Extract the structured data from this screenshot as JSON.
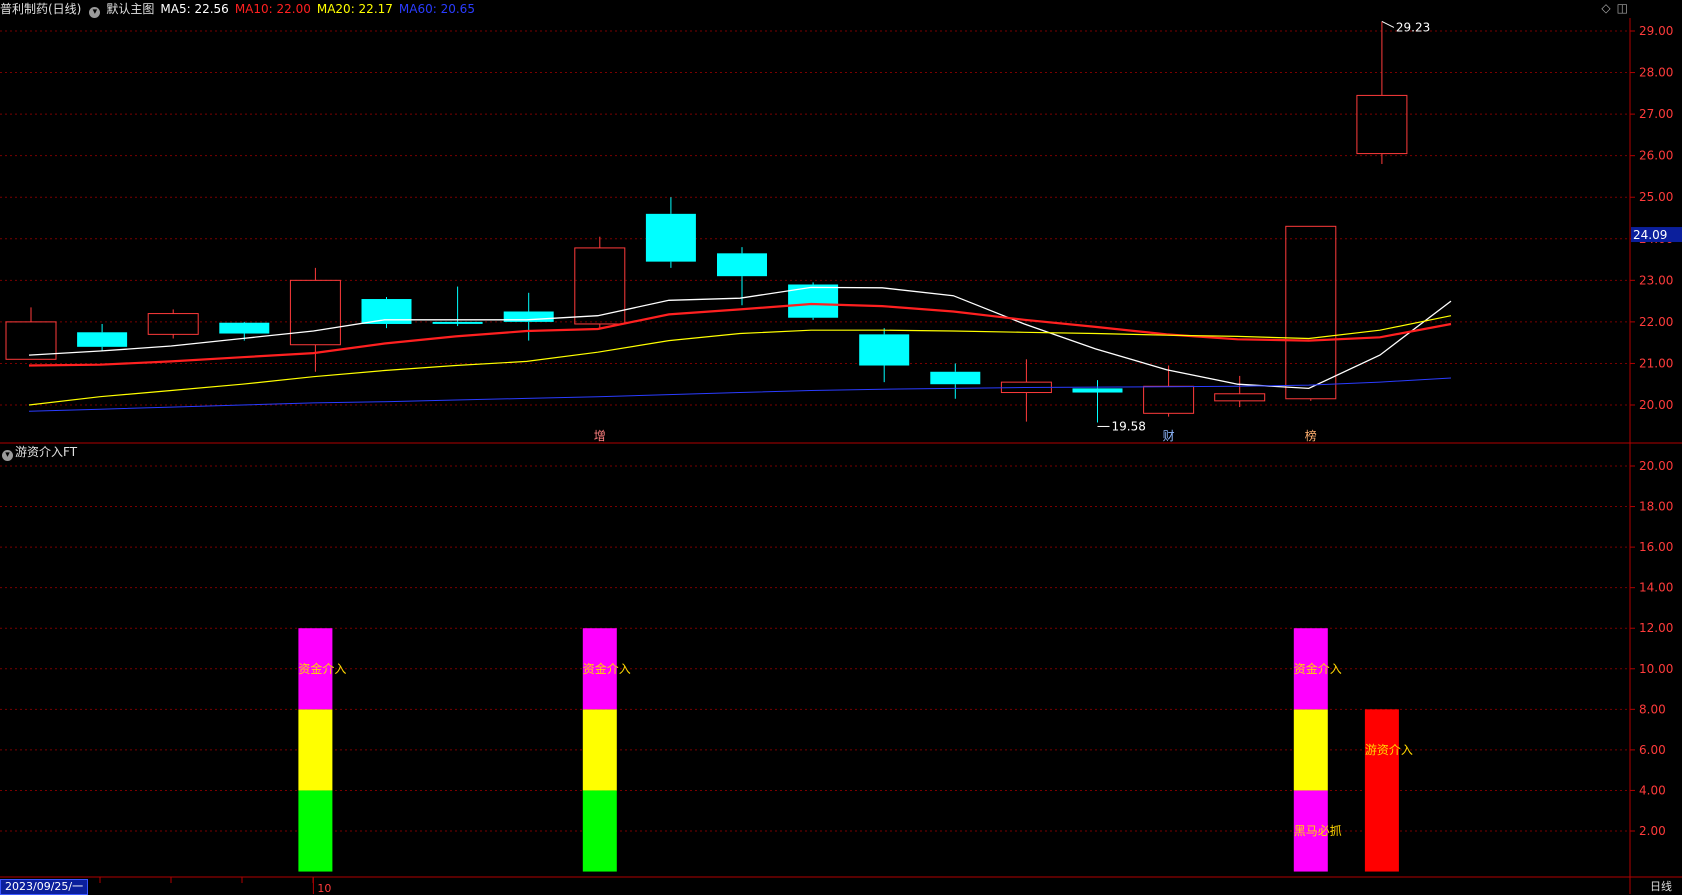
{
  "header": {
    "stock": "普利制药(日线)",
    "template": "默认主图",
    "ma": [
      {
        "label": "MA5: 22.56",
        "color": "#ffffff"
      },
      {
        "label": "MA10: 22.00",
        "color": "#ff2020"
      },
      {
        "label": "MA20: 22.17",
        "color": "#ffff00"
      },
      {
        "label": "MA60: 20.65",
        "color": "#2a3cff"
      }
    ],
    "icons": [
      "diamond-icon",
      "window-icon"
    ]
  },
  "sub_header": {
    "indicator": "游资介入FT"
  },
  "footer": {
    "date": "2023/09/25/一",
    "month_tick": "10",
    "period": "日线"
  },
  "colors": {
    "up": "#ff3b3b",
    "down": "#00ffff",
    "grid": "#7a0000",
    "axis": "#b00000",
    "ma5": "#ffffff",
    "ma10": "#ff2020",
    "ma20": "#ffff00",
    "ma60": "#2a3cff"
  },
  "chart_data": [
    {
      "type": "candlestick",
      "title": "普利制药(日线)",
      "ylim": [
        19.2,
        29.6
      ],
      "yticks": [
        "29.00",
        "28.00",
        "27.00",
        "26.00",
        "25.00",
        "24.00",
        "23.00",
        "22.00",
        "21.00",
        "20.00"
      ],
      "current_price": "24.09",
      "max_label": "29.23",
      "min_label": "19.58",
      "candles": [
        {
          "o": 21.1,
          "c": 22.0,
          "h": 22.35,
          "l": 21.1
        },
        {
          "o": 21.75,
          "c": 21.4,
          "h": 21.95,
          "l": 21.3
        },
        {
          "o": 21.7,
          "c": 22.2,
          "h": 22.3,
          "l": 21.6
        },
        {
          "o": 21.98,
          "c": 21.72,
          "h": 22.0,
          "l": 21.55
        },
        {
          "o": 21.45,
          "c": 23.0,
          "h": 23.3,
          "l": 20.8
        },
        {
          "o": 22.55,
          "c": 21.95,
          "h": 22.6,
          "l": 21.85
        },
        {
          "o": 22.0,
          "c": 21.97,
          "h": 22.85,
          "l": 21.9
        },
        {
          "o": 22.25,
          "c": 22.0,
          "h": 22.7,
          "l": 21.55
        },
        {
          "o": 21.95,
          "c": 23.78,
          "h": 24.05,
          "l": 21.85
        },
        {
          "o": 24.6,
          "c": 23.45,
          "h": 25.0,
          "l": 23.3
        },
        {
          "o": 23.65,
          "c": 23.1,
          "h": 23.8,
          "l": 22.4
        },
        {
          "o": 22.9,
          "c": 22.1,
          "h": 22.95,
          "l": 22.05
        },
        {
          "o": 21.7,
          "c": 20.95,
          "h": 21.85,
          "l": 20.55
        },
        {
          "o": 20.8,
          "c": 20.5,
          "h": 21.0,
          "l": 20.15
        },
        {
          "o": 20.3,
          "c": 20.55,
          "h": 21.1,
          "l": 19.6
        },
        {
          "o": 20.4,
          "c": 20.3,
          "h": 20.6,
          "l": 19.58
        },
        {
          "o": 19.8,
          "c": 20.45,
          "h": 20.95,
          "l": 19.72
        },
        {
          "o": 20.1,
          "c": 20.27,
          "h": 20.7,
          "l": 19.95
        },
        {
          "o": 20.15,
          "c": 24.3,
          "h": 24.3,
          "l": 20.1
        },
        {
          "o": 26.05,
          "c": 27.45,
          "h": 29.23,
          "l": 25.8
        }
      ],
      "series": [
        {
          "name": "MA5",
          "values": [
            21.2,
            21.3,
            21.42,
            21.6,
            21.78,
            22.05,
            22.05,
            22.05,
            22.15,
            22.52,
            22.57,
            22.83,
            22.82,
            22.63,
            21.95,
            21.35,
            20.85,
            20.5,
            20.4,
            21.2,
            22.5
          ]
        },
        {
          "name": "MA10",
          "values": [
            20.95,
            20.97,
            21.05,
            21.15,
            21.25,
            21.48,
            21.65,
            21.78,
            21.83,
            22.18,
            22.3,
            22.43,
            22.38,
            22.25,
            22.05,
            21.88,
            21.7,
            21.58,
            21.55,
            21.63,
            21.95
          ]
        },
        {
          "name": "MA20",
          "values": [
            20.0,
            20.2,
            20.35,
            20.5,
            20.68,
            20.83,
            20.95,
            21.05,
            21.27,
            21.55,
            21.72,
            21.8,
            21.8,
            21.78,
            21.75,
            21.72,
            21.68,
            21.65,
            21.6,
            21.8,
            22.15
          ]
        },
        {
          "name": "MA60",
          "values": [
            19.85,
            19.9,
            19.95,
            20.0,
            20.05,
            20.08,
            20.12,
            20.16,
            20.2,
            20.25,
            20.3,
            20.35,
            20.38,
            20.4,
            20.42,
            20.43,
            20.44,
            20.45,
            20.48,
            20.55,
            20.65
          ]
        }
      ],
      "event_markers": [
        {
          "index": 8,
          "label": "增",
          "color": "#ff8080"
        },
        {
          "index": 16,
          "label": "财",
          "color": "#8fb8ff"
        },
        {
          "index": 18,
          "label": "榜",
          "color": "#ffb070"
        }
      ]
    },
    {
      "type": "bar",
      "title": "游资介入FT",
      "ylim": [
        0,
        21
      ],
      "yticks": [
        "20.00",
        "18.00",
        "16.00",
        "14.00",
        "12.00",
        "10.00",
        "8.00",
        "6.00",
        "4.00",
        "2.00"
      ],
      "signals": [
        {
          "index": 4,
          "segments": [
            {
              "from": 0,
              "to": 4,
              "color": "#00ff00"
            },
            {
              "from": 4,
              "to": 8,
              "color": "#ffff00"
            },
            {
              "from": 8,
              "to": 12,
              "color": "#ff00ff"
            }
          ],
          "labels": [
            {
              "text": "资金介入",
              "y": 10
            }
          ]
        },
        {
          "index": 8,
          "segments": [
            {
              "from": 0,
              "to": 4,
              "color": "#00ff00"
            },
            {
              "from": 4,
              "to": 8,
              "color": "#ffff00"
            },
            {
              "from": 8,
              "to": 12,
              "color": "#ff00ff"
            }
          ],
          "labels": [
            {
              "text": "资金介入",
              "y": 10
            }
          ]
        },
        {
          "index": 18,
          "segments": [
            {
              "from": 0,
              "to": 4,
              "color": "#ff00ff"
            },
            {
              "from": 4,
              "to": 8,
              "color": "#ffff00"
            },
            {
              "from": 8,
              "to": 12,
              "color": "#ff00ff"
            }
          ],
          "labels": [
            {
              "text": "资金介入",
              "y": 10
            },
            {
              "text": "黑马必抓",
              "y": 2
            }
          ]
        },
        {
          "index": 19,
          "segments": [
            {
              "from": 0,
              "to": 8,
              "color": "#ff0000"
            }
          ],
          "labels": [
            {
              "text": "游资介入",
              "y": 6
            }
          ]
        }
      ]
    }
  ]
}
